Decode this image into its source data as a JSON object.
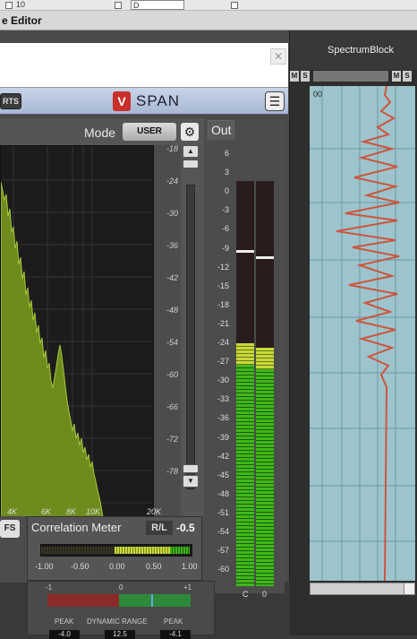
{
  "editor": {
    "title": "e Editor",
    "top_numeral": "10",
    "top_field": "D"
  },
  "plugin": {
    "close_glyph": "✕",
    "charts_label": "RTS",
    "logo_glyph": "V",
    "name": "SPAN",
    "menu_glyph": "☰",
    "mode_label": "Mode",
    "mode_value": "USER",
    "gear_glyph": "⚙",
    "y_ticks": [
      "-18",
      "-24",
      "-30",
      "-36",
      "-42",
      "-48",
      "-54",
      "-60",
      "-66",
      "-72",
      "-78"
    ],
    "x_ticks": [
      "4K",
      "6K",
      "8K",
      "10K",
      "20K"
    ],
    "scroll_up_glyph": "▲",
    "scroll_down_glyph": "▼",
    "play_glyph": "▶",
    "diamond_glyph": "◆"
  },
  "out_meter": {
    "tab_label": "Out",
    "scale": [
      "6",
      "3",
      "0",
      "-3",
      "-6",
      "-9",
      "-12",
      "-15",
      "-18",
      "-21",
      "-24",
      "-27",
      "-30",
      "-33",
      "-36",
      "-39",
      "-42",
      "-45",
      "-48",
      "-51",
      "-54",
      "-57",
      "-60"
    ],
    "channels": [
      "C",
      "0"
    ],
    "levels_db": [
      -20.5,
      -21.2
    ],
    "peaks_db": [
      -5.2,
      -6.3
    ]
  },
  "bottom": {
    "lufs_label": "FS",
    "correlation_title": "Correlation Meter",
    "rl_label": "R/L",
    "correlation_value": "-0.5",
    "corr_ticks": [
      "-1.00",
      "-0.50",
      "0.00",
      "0.50",
      "1.00"
    ],
    "dr_scale": [
      "-1",
      "0",
      "+1"
    ],
    "peak_label": "PEAK",
    "dynamic_range_label": "DYNAMIC RANGE",
    "peak_left": "-4.0",
    "dynamic_range_value": "12.5",
    "peak_right": "-4.1"
  },
  "track": {
    "name": "SpectrumBlock",
    "m_label": "M",
    "s_label": "S",
    "clip_label": "00"
  },
  "colors": {
    "spectrum_fill": "#6e8c1e",
    "meter_green": "#3fb818",
    "meter_yellow": "#c8d838",
    "lane_bg": "#9dc4cc",
    "waveform": "#d04a30"
  }
}
